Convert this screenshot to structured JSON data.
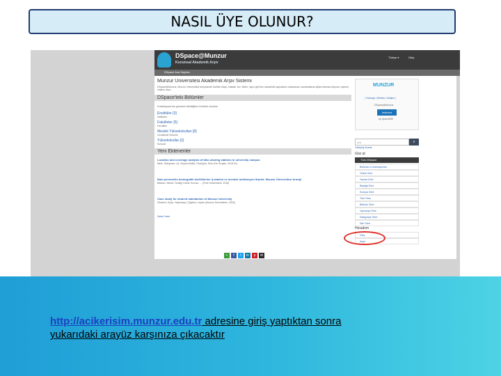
{
  "slide": {
    "title": "NASIL ÜYE OLUNUR?",
    "caption_url": "http://acikerisim.munzur.edu.tr",
    "caption_line1": " adresine giriş yaptıktan sonra",
    "caption_line2": "yukarıdaki arayüz karşınıza çıkacaktır"
  },
  "screenshot": {
    "header": {
      "title": "DSpace@Munzur",
      "subtitle": "Kurumsal Akademik Arşiv",
      "lang": "Türkçe ▾",
      "login": "Giriş"
    },
    "breadcrumb": "DSpace Ana Sayfası",
    "main": {
      "heading": "Munzur Üniversitesi Akademik Arşiv Sistemi",
      "intro": "DSpace@Munzur, Munzur Üniversitesi bünyesinde üretilen kitap, makale, tez, bildiri, rapor gibi tüm akademik kaynakları uluslararası standartlarda dijital ortamda depolar, arşivler, erişime açar...",
      "communities_title": "DSpace'teki Bölümler",
      "communities_hint": "Koleksiyonunu görmek istediğiniz bölümü seçiniz.",
      "communities": [
        {
          "name": "Enstitüler [3]",
          "sub": "Institutes"
        },
        {
          "name": "Fakülteler [5]",
          "sub": "Faculties"
        },
        {
          "name": "Meslek Yüksekokulları [8]",
          "sub": "Vocational Schools"
        },
        {
          "name": "Yüksekokullar [2]",
          "sub": "Schools"
        }
      ],
      "recent_title": "Yeni Eklenenler",
      "recent": [
        {
          "title": "Location and coverage analysis of bike-sharing stations in university campus",
          "meta": "Mete, Süleyman; Çil, Zeynel Abidin; Özceylan, Eren (De Gruyter, 2018-01)"
        },
        {
          "title": "İdari personelin demografik özelliklerine iş tatmini ve mesleki motivasyon ilişkisi: Munzur Üniversitesi örneği",
          "meta": "Baldacı, Mesut; Özdağ, Kamil; Kurnaz, ... (Fırat Üniversitesi, 2018)"
        },
        {
          "title": "Case study for student satisfaction of Munzur University",
          "meta": "Özdemir, Eyüp; Yalçınkaya, Çiğdem; Leylan (Munzur Üniversitesi, 2018)"
        }
      ],
      "more": "Daha Fazla"
    },
    "sidebar": {
      "logo_text": "MUNZUR",
      "links": "| Yönerge | Rehber | İletişim |",
      "badge_label": "DSpace@Munzur",
      "badge": "Indexed",
      "openaire": "by OpenAIRE",
      "search_placeholder": "Ara",
      "search_icon": "search-icon",
      "advanced": "Gelişmiş Arama",
      "browse_title": "Göz at",
      "browse_header": "Tüm DSpace",
      "browse_items": [
        "Bölümler & Koleksiyonlar",
        "Tarihe Göre",
        "Yazara Göre",
        "Başlığa Göre",
        "Konuya Göre",
        "Türe Göre",
        "Bölüme Göre",
        "Yayıncıya Göre",
        "Kategoriye Göre",
        "Dile Göre"
      ],
      "account_title": "Hesabım",
      "account_items": [
        "Giriş",
        "Kayıt"
      ]
    }
  }
}
